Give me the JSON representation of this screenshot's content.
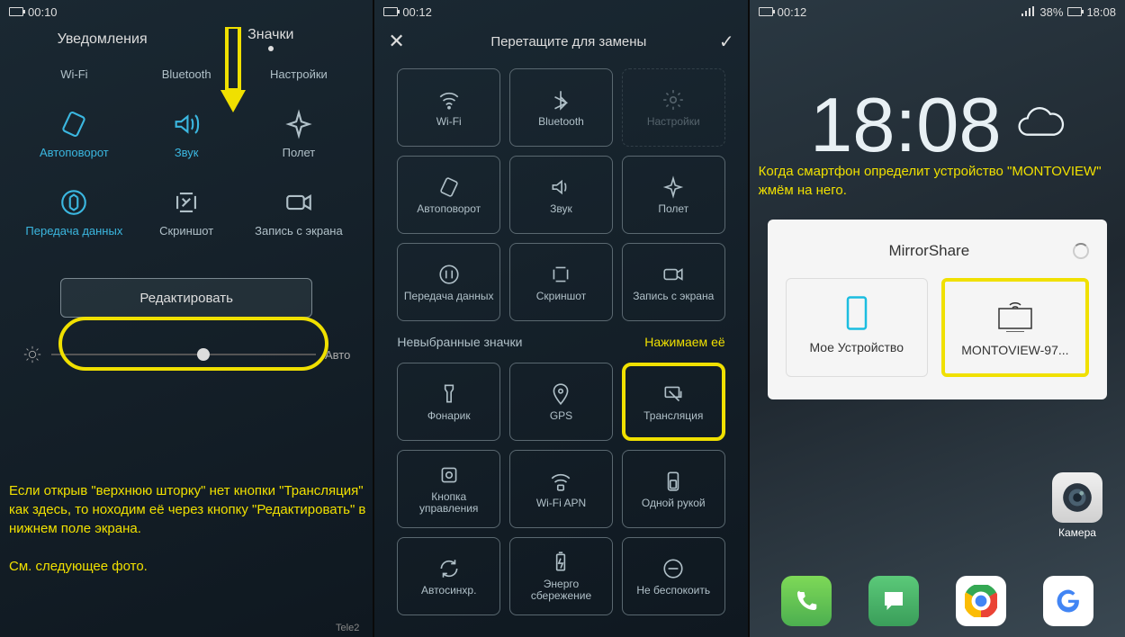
{
  "panel1": {
    "time": "00:10",
    "tab_notifications": "Уведомления",
    "tab_icons": "Значки",
    "row1": [
      "Wi-Fi",
      "Bluetooth",
      "Настройки"
    ],
    "tiles": [
      {
        "label": "Автоповорот",
        "active": true
      },
      {
        "label": "Звук",
        "active": true
      },
      {
        "label": "Полет",
        "active": false
      },
      {
        "label": "Передача данных",
        "active": true
      },
      {
        "label": "Скриншот",
        "active": false
      },
      {
        "label": "Запись с экрана",
        "active": false
      }
    ],
    "edit_button": "Редактировать",
    "auto_label": "Авто",
    "note": "Если открыв \"верхнюю шторку\" нет кнопки \"Трансляция\" как здесь, то ноходим её через кнопку \"Редактировать\" в нижнем поле экрана.\n\nСм. следующее фото.",
    "carrier": "Tele2"
  },
  "panel2": {
    "time": "00:12",
    "title": "Перетащите для замены",
    "selected_tiles": [
      "Wi-Fi",
      "Bluetooth",
      "Настройки",
      "Автоповорот",
      "Звук",
      "Полет",
      "Передача данных",
      "Скриншот",
      "Запись с экрана"
    ],
    "unselected_label": "Невыбранные значки",
    "hint": "Нажимаем её",
    "unselected_tiles": [
      "Фонарик",
      "GPS",
      "Трансляция",
      "Кнопка управления",
      "Wi-Fi APN",
      "Одной рукой",
      "Автосинхр.",
      "Энерго сбережение",
      "Не беспокоить"
    ]
  },
  "panel3": {
    "time_small": "00:12",
    "battery": "38%",
    "clock_time": "18:08",
    "note": "Когда смартфон определит устройство \"MONTOVIEW\" жмём на него.",
    "dialog_title": "MirrorShare",
    "device_mine": "Мое Устройство",
    "device_found": "MONTOVIEW-97...",
    "camera_label": "Камера"
  }
}
